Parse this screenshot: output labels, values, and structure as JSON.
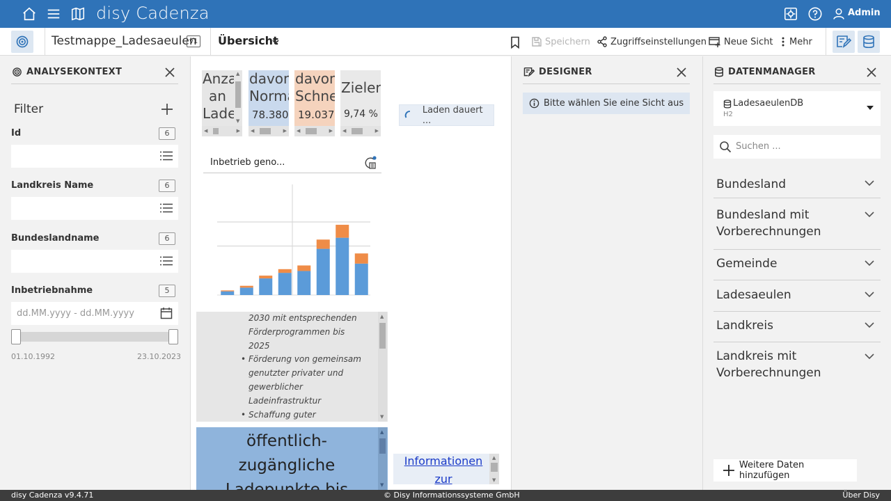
{
  "app": {
    "title": "disy Cadenza",
    "user": "Admin",
    "icons": [
      "home-icon",
      "menu-icon",
      "map-icon",
      "settings-icon",
      "help-icon",
      "user-icon"
    ],
    "brand_color": "#2f73b8"
  },
  "toolbar": {
    "workbook_name": "Testmappe_Ladesaeulen",
    "workbook_version": "v1",
    "view_title": "Übersicht",
    "save_label": "Speichern",
    "access_label": "Zugriffseinstellungen",
    "new_view_label": "Neue Sicht",
    "more_label": "Mehr"
  },
  "analysis": {
    "header": "ANALYSEKONTEXT",
    "filter_title": "Filter",
    "filters": [
      {
        "label": "Id",
        "count": "6"
      },
      {
        "label": "Landkreis Name",
        "count": "6"
      },
      {
        "label": "Bundeslandname",
        "count": "6"
      },
      {
        "label": "Inbetriebnahme",
        "count": "5"
      }
    ],
    "date_placeholder": "dd.MM.yyyy - dd.MM.yyyy",
    "range_start": "01.10.1992",
    "range_end": "23.10.2023"
  },
  "canvas": {
    "kpis": [
      {
        "title_lines": [
          "Anza",
          "an",
          "Lade"
        ],
        "value": "",
        "color": "#e6e6e6"
      },
      {
        "title_lines": [
          "davon",
          "Norma"
        ],
        "value": "78.380",
        "color": "#c9d9ed"
      },
      {
        "title_lines": [
          "davon",
          "Schnel"
        ],
        "value": "19.037",
        "color": "#f5d3bd"
      },
      {
        "title_lines": [
          "Zielerr"
        ],
        "value": "9,74 %",
        "color": "#e9e9e9"
      }
    ],
    "loading_text": "Laden dauert ...",
    "chart_title": "Inbetrieb geno...",
    "textbox_lines": [
      {
        "bullet": false,
        "text": "2030 mit entsprechenden"
      },
      {
        "bullet": false,
        "text": "Förderprogrammen bis"
      },
      {
        "bullet": false,
        "text": "2025"
      },
      {
        "bullet": true,
        "text": "Förderung von gemeinsam"
      },
      {
        "bullet": false,
        "text": "genutzter privater und"
      },
      {
        "bullet": false,
        "text": "gewerblicher"
      },
      {
        "bullet": false,
        "text": "Ladeinfrastruktur"
      },
      {
        "bullet": true,
        "text": "Schaffung guter"
      }
    ],
    "bluebox_lines": [
      "öffentlich-",
      "zugängliche",
      "Ladepunkte bis"
    ],
    "info_link_lines": [
      "Informationen",
      "zur räumlichen"
    ]
  },
  "chart_data": {
    "type": "bar",
    "stacked": true,
    "title": "Inbetrieb geno...",
    "categories": [
      "",
      "",
      "",
      "",
      "",
      "",
      "",
      ""
    ],
    "series": [
      {
        "values": [
          2,
          4,
          9,
          12,
          13,
          25,
          31,
          17
        ],
        "color": "#5b9bd9"
      },
      {
        "values": [
          0.5,
          1,
          1.5,
          2,
          3,
          5,
          7,
          5.5
        ],
        "color": "#ef8c47"
      }
    ],
    "ylim": [
      0,
      50
    ],
    "grid": true
  },
  "designer": {
    "header": "DESIGNER",
    "info": "Bitte wählen Sie eine Sicht aus"
  },
  "datamanager": {
    "header": "DATENMANAGER",
    "db_name": "LadesaeulenDB",
    "db_type": "H2",
    "search_placeholder": "Suchen ...",
    "items": [
      {
        "label_lines": [
          "Bundesland"
        ]
      },
      {
        "label_lines": [
          "Bundesland mit",
          "Vorberechnungen"
        ]
      },
      {
        "label_lines": [
          "Gemeinde"
        ]
      },
      {
        "label_lines": [
          "Ladesaeulen"
        ]
      },
      {
        "label_lines": [
          "Landkreis"
        ]
      },
      {
        "label_lines": [
          "Landkreis mit",
          "Vorberechnungen"
        ]
      }
    ],
    "add_label": "Weitere Daten hinzufügen"
  },
  "statusbar": {
    "version": "disy Cadenza v9.4.71",
    "copyright": "© Disy Informationssysteme GmbH",
    "about": "Über Disy"
  }
}
